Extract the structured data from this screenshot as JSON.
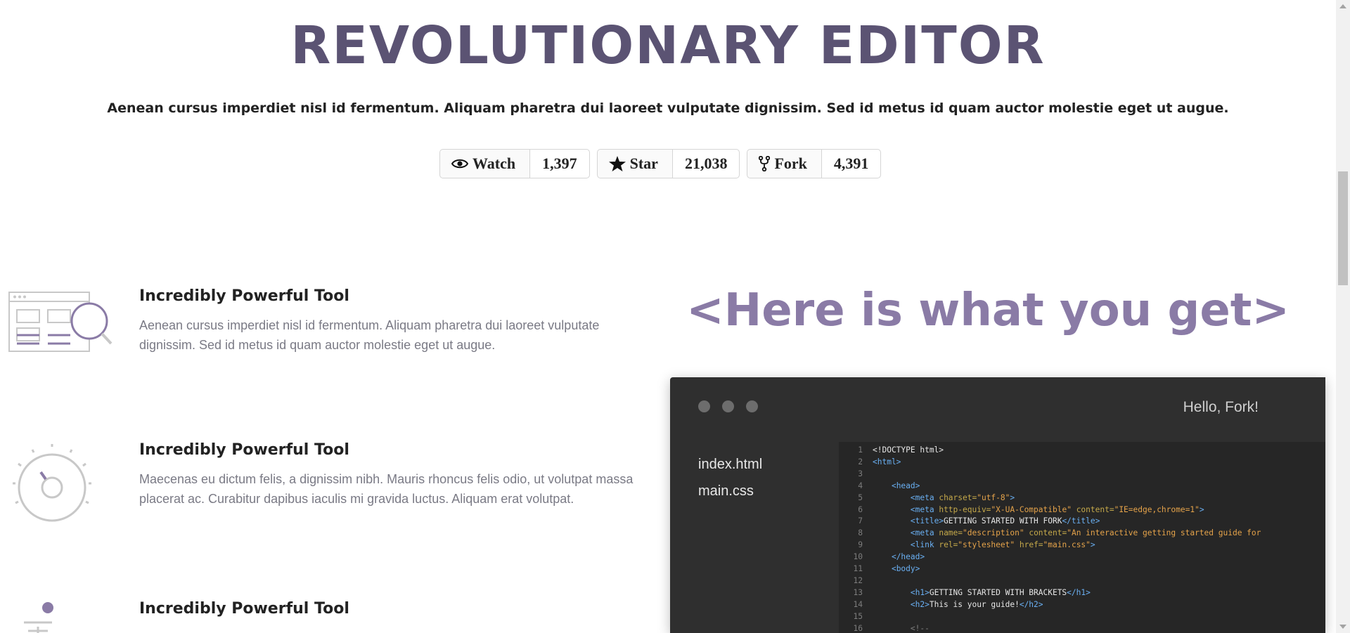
{
  "hero": {
    "title": "REVOLUTIONARY EDITOR",
    "subtitle": "Aenean cursus imperdiet nisl id fermentum. Aliquam pharetra dui laoreet vulputate dignissim. Sed id metus id quam auctor molestie eget ut augue."
  },
  "github": {
    "watch": {
      "label": "Watch",
      "count": "1,397",
      "icon": "eye-icon"
    },
    "star": {
      "label": "Star",
      "count": "21,038",
      "icon": "star-icon"
    },
    "fork": {
      "label": "Fork",
      "count": "4,391",
      "icon": "fork-icon"
    }
  },
  "features": [
    {
      "title": "Incredibly Powerful Tool",
      "text": "Aenean cursus imperdiet nisl id fermentum. Aliquam pharetra dui laoreet vulputate dignissim. Sed id metus id quam auctor molestie eget ut augue.",
      "icon": "browser-search-icon"
    },
    {
      "title": "Incredibly Powerful Tool",
      "text": "Maecenas eu dictum felis, a dignissim nibh. Mauris rhoncus felis odio, ut volutpat massa placerat ac. Curabitur dapibus iaculis mi gravida luctus. Aliquam erat volutpat.",
      "icon": "dial-icon"
    },
    {
      "title": "Incredibly Powerful Tool",
      "text": "",
      "icon": "stack-icon"
    }
  ],
  "showcase": {
    "title": "<Here is what you get>",
    "editor": {
      "greeting": "Hello, Fork!",
      "files": [
        "index.html",
        "main.css"
      ],
      "line_numbers": [
        "1",
        "2",
        "3",
        "4",
        "5",
        "6",
        "7",
        "8",
        "9",
        "10",
        "11",
        "12",
        "13",
        "14",
        "15",
        "16"
      ]
    }
  },
  "colors": {
    "accent": "#8a7ba6",
    "title": "#5b5373",
    "editor_bg": "#2f2f2f",
    "code_bg": "#262626"
  }
}
